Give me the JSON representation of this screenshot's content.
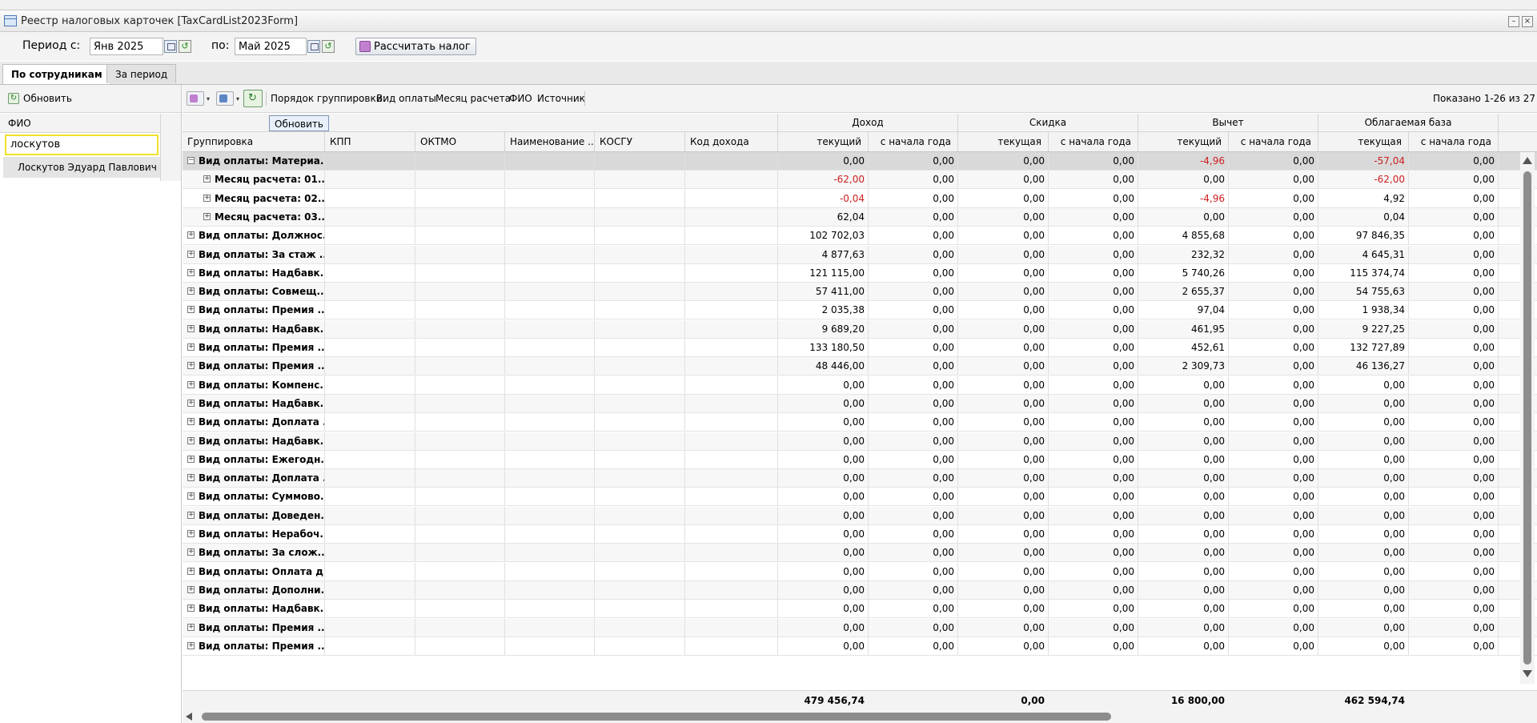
{
  "window": {
    "title": "Реестр налоговых карточек [TaxCardList2023Form]"
  },
  "filters": {
    "from_label": "Период с:",
    "from_value": "Янв 2025",
    "to_label": "по:",
    "to_value": "Май 2025",
    "calculate_label": "Рассчитать налог"
  },
  "tabs": [
    {
      "label": "По сотрудникам"
    },
    {
      "label": "За период"
    }
  ],
  "left": {
    "refresh_label": "Обновить",
    "column_header": "ФИО",
    "filter_value": "лоскутов",
    "employee": "Лоскутов Эдуард Павлович"
  },
  "main": {
    "grouping_label": "Порядок группировки:",
    "group_fields": [
      "Вид оплаты",
      "Месяц расчета",
      "ФИО",
      "Источник"
    ],
    "shown": "Показано 1-26 из 27",
    "tooltip": "Обновить",
    "headers_top": [
      "Доход",
      "Скидка",
      "Вычет",
      "Облагаемая база"
    ],
    "headers": [
      "Группировка",
      "КПП",
      "ОКТМО",
      "Наименование ...",
      "КОСГУ",
      "Код дохода",
      "текущий",
      "с начала года",
      "текущая",
      "с начала года",
      "текущий",
      "с начала года",
      "текущая",
      "с начала года"
    ],
    "colors": {
      "negative": "#cc1f1f",
      "selected_row": "#d9d9d9",
      "filter_border": "#f0e12a"
    }
  },
  "rows": [
    {
      "label": "Вид оплаты: Материа...",
      "level": 0,
      "state": "−",
      "sel": true,
      "values": [
        "0,00",
        "0,00",
        "0,00",
        "0,00",
        "-4,96",
        "0,00",
        "-57,04",
        "0,00"
      ]
    },
    {
      "label": "Месяц расчета: 01....",
      "level": 1,
      "state": "+",
      "values": [
        "-62,00",
        "0,00",
        "0,00",
        "0,00",
        "0,00",
        "0,00",
        "-62,00",
        "0,00"
      ]
    },
    {
      "label": "Месяц расчета: 02....",
      "level": 1,
      "state": "+",
      "values": [
        "-0,04",
        "0,00",
        "0,00",
        "0,00",
        "-4,96",
        "0,00",
        "4,92",
        "0,00"
      ]
    },
    {
      "label": "Месяц расчета: 03....",
      "level": 1,
      "state": "+",
      "values": [
        "62,04",
        "0,00",
        "0,00",
        "0,00",
        "0,00",
        "0,00",
        "0,04",
        "0,00"
      ]
    },
    {
      "label": "Вид оплаты: Должнос...",
      "level": 0,
      "state": "+",
      "values": [
        "102 702,03",
        "0,00",
        "0,00",
        "0,00",
        "4 855,68",
        "0,00",
        "97 846,35",
        "0,00"
      ]
    },
    {
      "label": "Вид оплаты: За стаж ...",
      "level": 0,
      "state": "+",
      "values": [
        "4 877,63",
        "0,00",
        "0,00",
        "0,00",
        "232,32",
        "0,00",
        "4 645,31",
        "0,00"
      ]
    },
    {
      "label": "Вид оплаты: Надбавк...",
      "level": 0,
      "state": "+",
      "values": [
        "121 115,00",
        "0,00",
        "0,00",
        "0,00",
        "5 740,26",
        "0,00",
        "115 374,74",
        "0,00"
      ]
    },
    {
      "label": "Вид оплаты: Совмещ...",
      "level": 0,
      "state": "+",
      "values": [
        "57 411,00",
        "0,00",
        "0,00",
        "0,00",
        "2 655,37",
        "0,00",
        "54 755,63",
        "0,00"
      ]
    },
    {
      "label": "Вид оплаты: Премия ...",
      "level": 0,
      "state": "+",
      "values": [
        "2 035,38",
        "0,00",
        "0,00",
        "0,00",
        "97,04",
        "0,00",
        "1 938,34",
        "0,00"
      ]
    },
    {
      "label": "Вид оплаты: Надбавк...",
      "level": 0,
      "state": "+",
      "values": [
        "9 689,20",
        "0,00",
        "0,00",
        "0,00",
        "461,95",
        "0,00",
        "9 227,25",
        "0,00"
      ]
    },
    {
      "label": "Вид оплаты: Премия ...",
      "level": 0,
      "state": "+",
      "values": [
        "133 180,50",
        "0,00",
        "0,00",
        "0,00",
        "452,61",
        "0,00",
        "132 727,89",
        "0,00"
      ]
    },
    {
      "label": "Вид оплаты: Премия ...",
      "level": 0,
      "state": "+",
      "values": [
        "48 446,00",
        "0,00",
        "0,00",
        "0,00",
        "2 309,73",
        "0,00",
        "46 136,27",
        "0,00"
      ]
    },
    {
      "label": "Вид оплаты: Компенс...",
      "level": 0,
      "state": "+",
      "values": [
        "0,00",
        "0,00",
        "0,00",
        "0,00",
        "0,00",
        "0,00",
        "0,00",
        "0,00"
      ]
    },
    {
      "label": "Вид оплаты: Надбавк...",
      "level": 0,
      "state": "+",
      "values": [
        "0,00",
        "0,00",
        "0,00",
        "0,00",
        "0,00",
        "0,00",
        "0,00",
        "0,00"
      ]
    },
    {
      "label": "Вид оплаты: Доплата ...",
      "level": 0,
      "state": "+",
      "values": [
        "0,00",
        "0,00",
        "0,00",
        "0,00",
        "0,00",
        "0,00",
        "0,00",
        "0,00"
      ]
    },
    {
      "label": "Вид оплаты: Надбавк...",
      "level": 0,
      "state": "+",
      "values": [
        "0,00",
        "0,00",
        "0,00",
        "0,00",
        "0,00",
        "0,00",
        "0,00",
        "0,00"
      ]
    },
    {
      "label": "Вид оплаты: Ежегодн...",
      "level": 0,
      "state": "+",
      "values": [
        "0,00",
        "0,00",
        "0,00",
        "0,00",
        "0,00",
        "0,00",
        "0,00",
        "0,00"
      ]
    },
    {
      "label": "Вид оплаты: Доплата ...",
      "level": 0,
      "state": "+",
      "values": [
        "0,00",
        "0,00",
        "0,00",
        "0,00",
        "0,00",
        "0,00",
        "0,00",
        "0,00"
      ]
    },
    {
      "label": "Вид оплаты: Суммово...",
      "level": 0,
      "state": "+",
      "values": [
        "0,00",
        "0,00",
        "0,00",
        "0,00",
        "0,00",
        "0,00",
        "0,00",
        "0,00"
      ]
    },
    {
      "label": "Вид оплаты: Доведен...",
      "level": 0,
      "state": "+",
      "values": [
        "0,00",
        "0,00",
        "0,00",
        "0,00",
        "0,00",
        "0,00",
        "0,00",
        "0,00"
      ]
    },
    {
      "label": "Вид оплаты: Нерабоч...",
      "level": 0,
      "state": "+",
      "values": [
        "0,00",
        "0,00",
        "0,00",
        "0,00",
        "0,00",
        "0,00",
        "0,00",
        "0,00"
      ]
    },
    {
      "label": "Вид оплаты: За слож...",
      "level": 0,
      "state": "+",
      "values": [
        "0,00",
        "0,00",
        "0,00",
        "0,00",
        "0,00",
        "0,00",
        "0,00",
        "0,00"
      ]
    },
    {
      "label": "Вид оплаты: Оплата д...",
      "level": 0,
      "state": "+",
      "values": [
        "0,00",
        "0,00",
        "0,00",
        "0,00",
        "0,00",
        "0,00",
        "0,00",
        "0,00"
      ]
    },
    {
      "label": "Вид оплаты: Дополни...",
      "level": 0,
      "state": "+",
      "values": [
        "0,00",
        "0,00",
        "0,00",
        "0,00",
        "0,00",
        "0,00",
        "0,00",
        "0,00"
      ]
    },
    {
      "label": "Вид оплаты: Надбавк...",
      "level": 0,
      "state": "+",
      "values": [
        "0,00",
        "0,00",
        "0,00",
        "0,00",
        "0,00",
        "0,00",
        "0,00",
        "0,00"
      ]
    },
    {
      "label": "Вид оплаты: Премия ...",
      "level": 0,
      "state": "+",
      "values": [
        "0,00",
        "0,00",
        "0,00",
        "0,00",
        "0,00",
        "0,00",
        "0,00",
        "0,00"
      ]
    },
    {
      "label": "Вид оплаты: Премия ...",
      "level": 0,
      "state": "+",
      "values": [
        "0,00",
        "0,00",
        "0,00",
        "0,00",
        "0,00",
        "0,00",
        "0,00",
        "0,00"
      ]
    }
  ],
  "totals": {
    "income": "479 456,74",
    "discount": "0,00",
    "deduction": "16 800,00",
    "taxable": "462 594,74"
  }
}
